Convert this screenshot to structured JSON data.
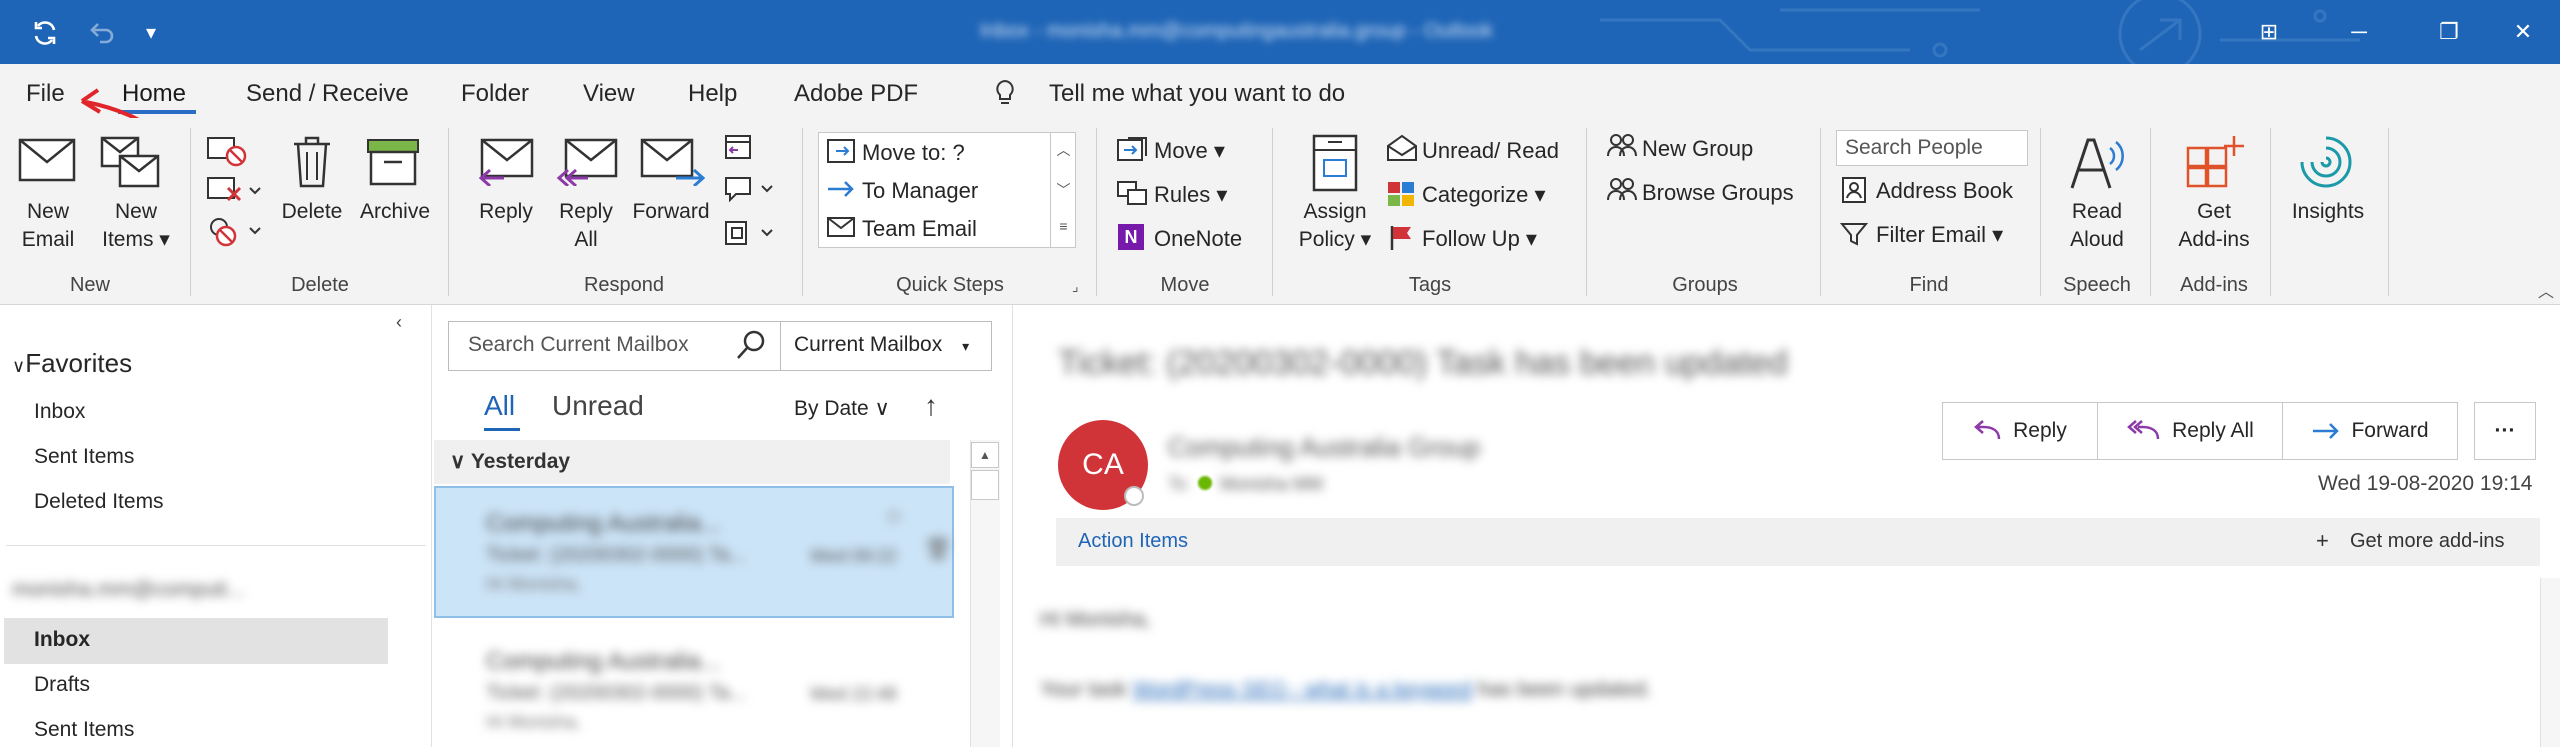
{
  "titlebar": {
    "window_title": "Inbox - monisha.mm@computingaustralia.group - Outlook"
  },
  "tabs": [
    "File",
    "Home",
    "Send / Receive",
    "Folder",
    "View",
    "Help",
    "Adobe PDF"
  ],
  "tell_me": "Tell me what you want to do",
  "ribbon": {
    "new": {
      "new_email": [
        "New",
        "Email"
      ],
      "new_items": [
        "New",
        "Items"
      ],
      "group": "New"
    },
    "delete": {
      "delete": "Delete",
      "archive": "Archive",
      "group": "Delete"
    },
    "respond": {
      "reply": "Reply",
      "reply_all": [
        "Reply",
        "All"
      ],
      "forward": "Forward",
      "group": "Respond"
    },
    "quick_steps": {
      "items": [
        "Move to: ?",
        "To Manager",
        "Team Email"
      ],
      "group": "Quick Steps"
    },
    "move": {
      "move": "Move",
      "rules": "Rules",
      "onenote": "OneNote",
      "group": "Move"
    },
    "tags": {
      "assign_policy": [
        "Assign",
        "Policy"
      ],
      "unread_read": "Unread/ Read",
      "categorize": "Categorize",
      "follow_up": "Follow Up",
      "group": "Tags"
    },
    "groups": {
      "new_group": "New Group",
      "browse_groups": "Browse Groups",
      "group": "Groups"
    },
    "find": {
      "search_people": "Search People",
      "address_book": "Address Book",
      "filter_email": "Filter Email",
      "group": "Find"
    },
    "speech": {
      "read_aloud": [
        "Read",
        "Aloud"
      ],
      "group": "Speech"
    },
    "addins": {
      "get_addins": [
        "Get",
        "Add-ins"
      ],
      "group": "Add-ins"
    },
    "insights": {
      "label": "Insights"
    }
  },
  "nav": {
    "favorites_title": "Favorites",
    "favorites": [
      "Inbox",
      "Sent Items",
      "Deleted Items"
    ],
    "account": "monisha.mm@computi...",
    "folders": [
      "Inbox",
      "Drafts",
      "Sent Items"
    ]
  },
  "list": {
    "search_placeholder": "Search Current Mailbox",
    "scope": "Current Mailbox",
    "filter_all": "All",
    "filter_unread": "Unread",
    "sort": "By Date",
    "group_header": "Yesterday",
    "messages": [
      {
        "from": "Computing Australia...",
        "subject": "Ticket: (20200302-0000) Ta...",
        "preview": "Hi Monisha,",
        "time": "Wed 09:22"
      },
      {
        "from": "Computing Australia...",
        "subject": "Ticket: (20200302-0000) Ta...",
        "preview": "Hi Monisha,",
        "time": "Wed 22:48"
      }
    ]
  },
  "reading": {
    "subject": "Ticket: (20200302-0000) Task has been updated",
    "avatar": "CA",
    "sender": "Computing Australia Group",
    "to_label": "To",
    "to": "Monisha MM",
    "datetime": "Wed 19-08-2020 19:14",
    "reply": "Reply",
    "reply_all": "Reply All",
    "forward": "Forward",
    "more": "···",
    "action_items": "Action Items",
    "get_more_addins": "Get more add-ins",
    "greeting": "Hi Monisha,",
    "body_pre": "Your task",
    "body_link": "WordPress SEO - what is a keyword",
    "body_post": "has been updated."
  },
  "colors": {
    "accent": "#1f65b7",
    "avatar": "#d13438",
    "annotation_arrow": "#e0262a",
    "selected_row": "#cce4f7"
  }
}
